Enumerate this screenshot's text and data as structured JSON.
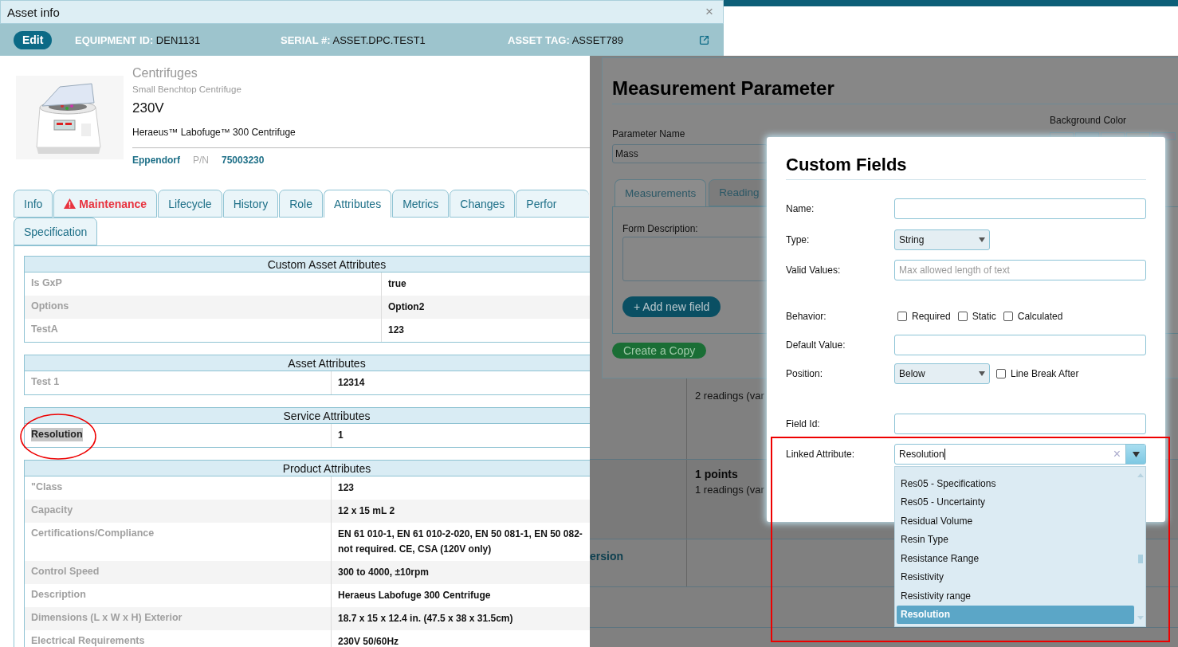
{
  "asset_window": {
    "title": "Asset info",
    "close": "×",
    "edit_button": "Edit",
    "fields": [
      {
        "label": "EQUIPMENT ID:",
        "value": "DEN1131"
      },
      {
        "label": "SERIAL #:",
        "value": "ASSET.DPC.TEST1"
      },
      {
        "label": "ASSET TAG:",
        "value": "ASSET789"
      }
    ],
    "product": {
      "category": "Centrifuges",
      "subtitle": "Small Benchtop Centrifuge",
      "voltage": "230V",
      "name": "Heraeus™ Labofuge™ 300 Centrifuge",
      "manufacturer": "Eppendorf",
      "pn_label": "P/N",
      "pn": "75003230"
    },
    "tab_rows": [
      [
        {
          "label": "Info",
          "selected": false,
          "warning": false
        },
        {
          "label": "Maintenance",
          "selected": false,
          "warning": true
        },
        {
          "label": "Lifecycle",
          "selected": false,
          "warning": false
        },
        {
          "label": "History",
          "selected": false,
          "warning": false
        },
        {
          "label": "Role",
          "selected": false,
          "warning": false
        },
        {
          "label": "Attributes",
          "selected": true,
          "warning": false
        },
        {
          "label": "Metrics",
          "selected": false,
          "warning": false
        },
        {
          "label": "Changes",
          "selected": false,
          "warning": false
        },
        {
          "label": "Perfor",
          "selected": false,
          "warning": false
        }
      ],
      [
        {
          "label": "Specification",
          "selected": false,
          "warning": false
        }
      ]
    ],
    "sections": [
      {
        "title": "Custom Asset Attributes",
        "rows": [
          {
            "label": "Is GxP",
            "value": [
              "true"
            ]
          },
          {
            "label": "Options",
            "value": [
              "Option2"
            ]
          },
          {
            "label": "TestA",
            "value": [
              "123"
            ]
          }
        ]
      },
      {
        "title": "Asset Attributes",
        "rows": [
          {
            "label": "Test 1",
            "value": [
              "12314"
            ]
          }
        ]
      },
      {
        "title": "Service Attributes",
        "rows": [
          {
            "label": "Resolution",
            "value": [
              "1"
            ],
            "highlighted": true,
            "circled": true
          }
        ]
      },
      {
        "title": "Product Attributes",
        "rows": [
          {
            "label": "\"Class",
            "value": [
              "123"
            ]
          },
          {
            "label": "Capacity",
            "value": [
              "12 x 15 mL 2"
            ]
          },
          {
            "label": "Certifications/Compliance",
            "value": [
              "EN 61 010-1, EN 61 010-2-020, EN 50 081-1, EN 50 082-",
              "not required. CE, CSA (120V only)"
            ]
          },
          {
            "label": "Control Speed",
            "value": [
              "300 to 4000, ±10rpm"
            ]
          },
          {
            "label": "Description",
            "value": [
              "Heraeus Labofuge 300 Centrifuge"
            ]
          },
          {
            "label": "Dimensions (L x W x H) Exterior",
            "value": [
              "18.7 x 15 x 12.4 in. (47.5 x 38 x 31.5cm)"
            ]
          },
          {
            "label": "Electrical Requirements",
            "value": [
              "230V 50/60Hz"
            ]
          }
        ]
      }
    ]
  },
  "background_table": {
    "rows": [
      {
        "left": "",
        "title": "",
        "detail": "2 readings (var"
      },
      {
        "left": "",
        "title": "1 points",
        "detail": "1 readings (var"
      },
      {
        "left": "ersion",
        "title": "",
        "detail": ""
      }
    ]
  },
  "measurement_dialog": {
    "title": "Measurement Parameter",
    "name_label": "Parameter Name",
    "name_value": "Mass",
    "color_label": "Background Color",
    "tabs": [
      {
        "label": "Measurements",
        "selected": true
      },
      {
        "label": "Reading",
        "selected": false
      }
    ],
    "description_label": "Form Description:",
    "add_button": "+ Add new field",
    "copy_button": "Create a Copy"
  },
  "custom_fields_dialog": {
    "title": "Custom Fields",
    "rows": [
      {
        "kind": "input",
        "label": "Name:",
        "value": ""
      },
      {
        "kind": "select",
        "label": "Type:",
        "value": "String"
      },
      {
        "kind": "input",
        "label": "Valid Values:",
        "placeholder": "Max allowed length of text"
      },
      {
        "kind": "checkboxes",
        "label": "Behavior:",
        "options": [
          {
            "label": "Required",
            "checked": false
          },
          {
            "label": "Static",
            "checked": false
          },
          {
            "label": "Calculated",
            "checked": false
          }
        ]
      },
      {
        "kind": "input",
        "label": "Default Value:",
        "value": ""
      },
      {
        "kind": "select",
        "label": "Position:",
        "value": "Below",
        "checkbox": {
          "label": "Line Break After",
          "checked": false
        }
      },
      {
        "kind": "input",
        "label": "Field Id:",
        "value": ""
      },
      {
        "kind": "combobox",
        "label": "Linked Attribute:",
        "value": "Resolution",
        "clear": "×",
        "outlined": true,
        "options": [
          {
            "label": "Res05 - Specifications",
            "selected": false
          },
          {
            "label": "Res05 - Uncertainty",
            "selected": false
          },
          {
            "label": "Residual Volume",
            "selected": false
          },
          {
            "label": "Resin Type",
            "selected": false
          },
          {
            "label": "Resistance Range",
            "selected": false
          },
          {
            "label": "Resistivity",
            "selected": false
          },
          {
            "label": "Resistivity range",
            "selected": false
          },
          {
            "label": "Resolution",
            "selected": true
          }
        ]
      }
    ]
  }
}
